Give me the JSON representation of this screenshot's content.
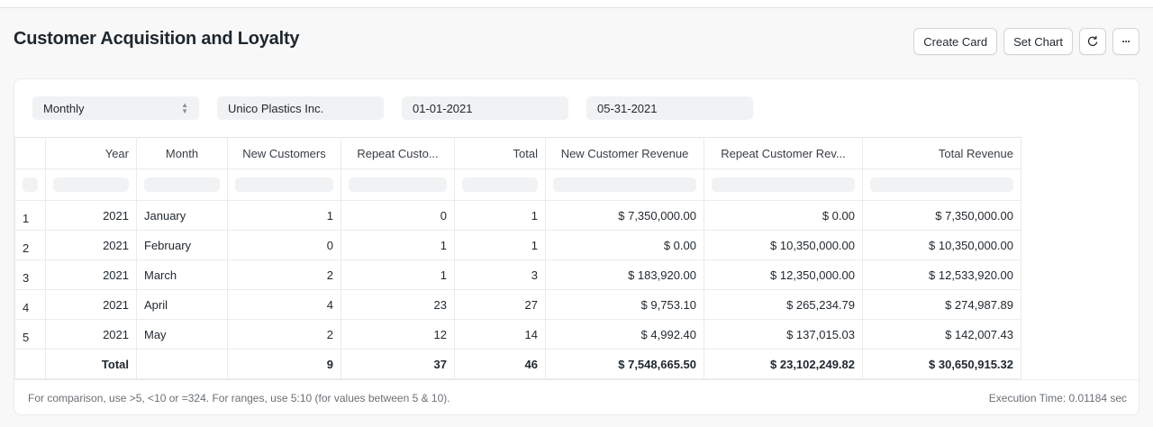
{
  "page": {
    "title": "Customer Acquisition and Loyalty"
  },
  "actions": {
    "create_card": "Create Card",
    "set_chart": "Set Chart",
    "refresh_icon": "refresh-icon",
    "more_icon": "more-icon",
    "more_glyph": "···"
  },
  "filters": {
    "period": "Monthly",
    "customer": "Unico Plastics Inc.",
    "from_date": "01-01-2021",
    "to_date": "05-31-2021"
  },
  "table": {
    "columns": [
      "Year",
      "Month",
      "New Customers",
      "Repeat Custo...",
      "Total",
      "New Customer Revenue",
      "Repeat Customer Rev...",
      "Total Revenue"
    ],
    "rows": [
      {
        "index": "1",
        "year": "2021",
        "month": "January",
        "new_customers": "1",
        "repeat_customers": "0",
        "total": "1",
        "new_revenue": "$ 7,350,000.00",
        "repeat_revenue": "$ 0.00",
        "total_revenue": "$ 7,350,000.00"
      },
      {
        "index": "2",
        "year": "2021",
        "month": "February",
        "new_customers": "0",
        "repeat_customers": "1",
        "total": "1",
        "new_revenue": "$ 0.00",
        "repeat_revenue": "$ 10,350,000.00",
        "total_revenue": "$ 10,350,000.00"
      },
      {
        "index": "3",
        "year": "2021",
        "month": "March",
        "new_customers": "2",
        "repeat_customers": "1",
        "total": "3",
        "new_revenue": "$ 183,920.00",
        "repeat_revenue": "$ 12,350,000.00",
        "total_revenue": "$ 12,533,920.00"
      },
      {
        "index": "4",
        "year": "2021",
        "month": "April",
        "new_customers": "4",
        "repeat_customers": "23",
        "total": "27",
        "new_revenue": "$ 9,753.10",
        "repeat_revenue": "$ 265,234.79",
        "total_revenue": "$ 274,987.89"
      },
      {
        "index": "5",
        "year": "2021",
        "month": "May",
        "new_customers": "2",
        "repeat_customers": "12",
        "total": "14",
        "new_revenue": "$ 4,992.40",
        "repeat_revenue": "$ 137,015.03",
        "total_revenue": "$ 142,007.43"
      }
    ],
    "totals": {
      "label": "Total",
      "new_customers": "9",
      "repeat_customers": "37",
      "total": "46",
      "new_revenue": "$ 7,548,665.50",
      "repeat_revenue": "$ 23,102,249.82",
      "total_revenue": "$ 30,650,915.32"
    }
  },
  "footer": {
    "hint": "For comparison, use >5, <10 or =324. For ranges, use 5:10 (for values between 5 & 10).",
    "execution_time": "Execution Time: 0.01184 sec"
  }
}
